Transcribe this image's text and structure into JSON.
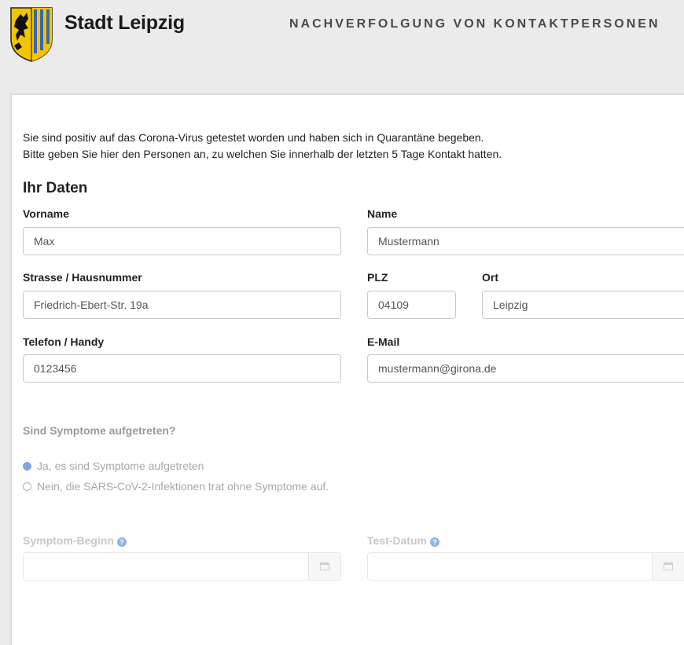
{
  "header": {
    "brand": "Stadt Leipzig",
    "title": "NACHVERFOLGUNG VON KONTAKTPERSONEN",
    "logo_icon": "leipzig-coat-of-arms-icon"
  },
  "intro": {
    "line1": "Sie sind positiv auf das Corona-Virus getestet worden und haben sich in Quarantäne begeben.",
    "line2": "Bitte geben Sie hier den Personen an, zu welchen Sie innerhalb der letzten 5 Tage Kontakt hatten."
  },
  "section": {
    "title": "Ihr Daten"
  },
  "form": {
    "vorname": {
      "label": "Vorname",
      "value": "Max"
    },
    "name": {
      "label": "Name",
      "value": "Mustermann"
    },
    "strasse": {
      "label": "Strasse / Hausnummer",
      "value": "Friedrich-Ebert-Str. 19a"
    },
    "plz": {
      "label": "PLZ",
      "value": "04109"
    },
    "ort": {
      "label": "Ort",
      "value": "Leipzig"
    },
    "telefon": {
      "label": "Telefon / Handy",
      "value": "0123456"
    },
    "email": {
      "label": "E-Mail",
      "value": "mustermann@girona.de"
    }
  },
  "symptoms": {
    "question": "Sind Symptome aufgetreten?",
    "option_yes": "Ja, es sind Symptome aufgetreten",
    "option_no": "Nein, die SARS-CoV-2-Infektionen trat ohne Symptome auf.",
    "selected": "yes"
  },
  "dates": {
    "symptom_beginn_label": "Symptom-Beginn",
    "test_datum_label": "Test-Datum",
    "help_icon": "question-circle-icon",
    "calendar_icon": "calendar-icon"
  },
  "colors": {
    "page_bg": "#ebebeb",
    "card_bg": "#ffffff",
    "accent_blue": "#7fa8d8",
    "crest_yellow": "#f2c500",
    "crest_blue": "#3a66b0"
  }
}
